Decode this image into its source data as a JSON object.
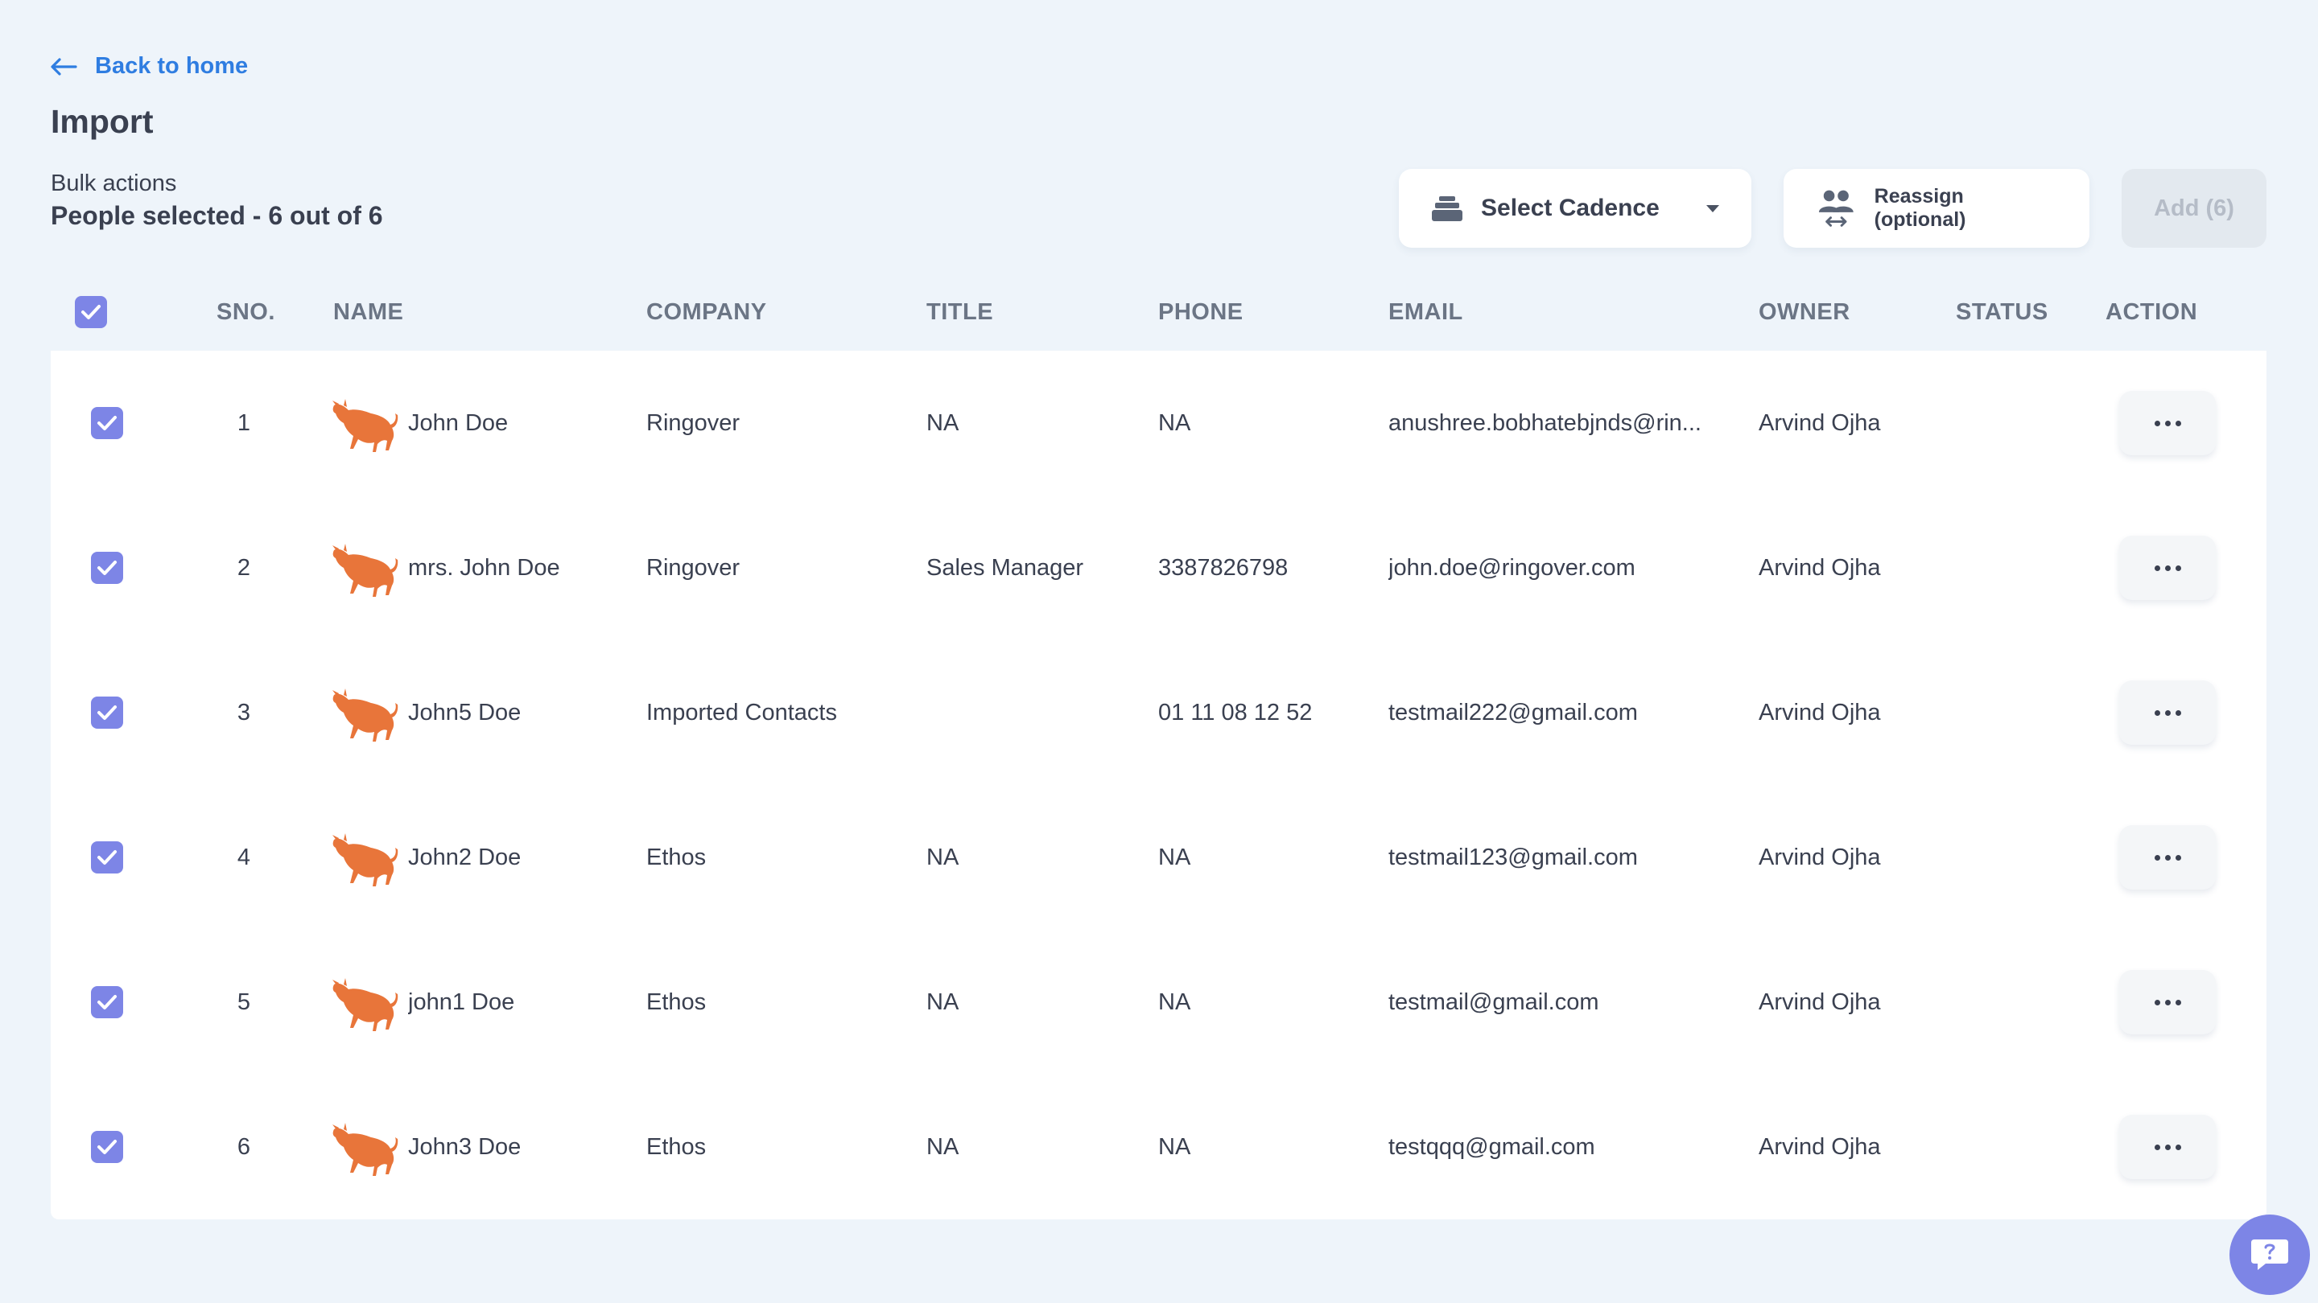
{
  "nav": {
    "back_label": "Back to home"
  },
  "header": {
    "title": "Import",
    "bulk_actions_label": "Bulk actions",
    "selection_summary": "People selected - 6 out of 6"
  },
  "toolbar": {
    "select_cadence_label": "Select Cadence",
    "reassign_label": "Reassign (optional)",
    "add_label": "Add (6)"
  },
  "table": {
    "columns": [
      "SNO.",
      "NAME",
      "COMPANY",
      "TITLE",
      "PHONE",
      "EMAIL",
      "OWNER",
      "STATUS",
      "ACTION"
    ],
    "rows": [
      {
        "sno": "1",
        "name": "John Doe",
        "company": "Ringover",
        "title": "NA",
        "phone": "NA",
        "email": "anushree.bobhatebjnds@rin...",
        "owner": "Arvind Ojha",
        "status": ""
      },
      {
        "sno": "2",
        "name": "mrs. John Doe",
        "company": "Ringover",
        "title": "Sales Manager",
        "phone": "3387826798",
        "email": "john.doe@ringover.com",
        "owner": "Arvind Ojha",
        "status": ""
      },
      {
        "sno": "3",
        "name": "John5 Doe",
        "company": "Imported Contacts",
        "title": "",
        "phone": "01 11 08 12 52",
        "email": "testmail222@gmail.com",
        "owner": "Arvind Ojha",
        "status": ""
      },
      {
        "sno": "4",
        "name": "John2 Doe",
        "company": "Ethos",
        "title": "NA",
        "phone": "NA",
        "email": "testmail123@gmail.com",
        "owner": "Arvind Ojha",
        "status": ""
      },
      {
        "sno": "5",
        "name": "john1 Doe",
        "company": "Ethos",
        "title": "NA",
        "phone": "NA",
        "email": "testmail@gmail.com",
        "owner": "Arvind Ojha",
        "status": ""
      },
      {
        "sno": "6",
        "name": "John3 Doe",
        "company": "Ethos",
        "title": "NA",
        "phone": "NA",
        "email": "testqqq@gmail.com",
        "owner": "Arvind Ojha",
        "status": ""
      }
    ]
  },
  "colors": {
    "background": "#eef4fa",
    "accent": "#2f7de1",
    "checkbox": "#7d85e6",
    "avatar": "#e8753a",
    "add_disabled_bg": "#e3e9ef"
  }
}
